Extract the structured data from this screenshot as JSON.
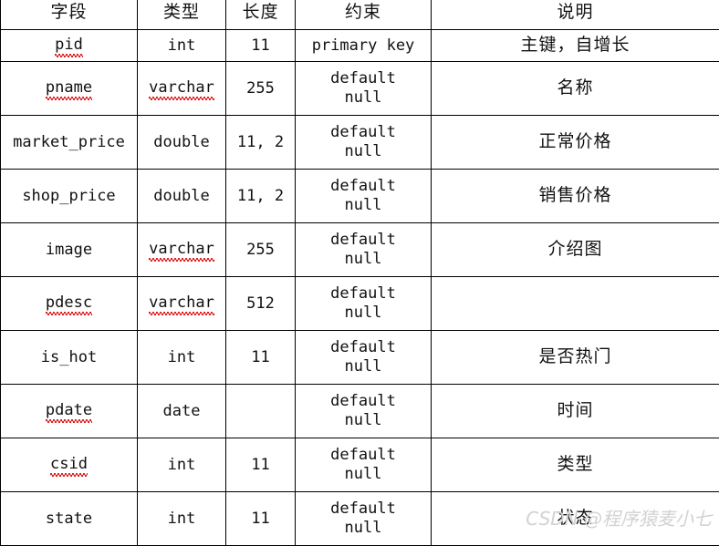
{
  "table": {
    "headers": [
      {
        "label": "字段",
        "key": "field"
      },
      {
        "label": "类型",
        "key": "type"
      },
      {
        "label": "长度",
        "key": "length"
      },
      {
        "label": "约束",
        "key": "constraint"
      },
      {
        "label": "说明",
        "key": "description"
      }
    ],
    "rows": [
      {
        "field": "pid",
        "field_misspelled": true,
        "type": "int",
        "type_misspelled": false,
        "length": "11",
        "constraint": "primary key",
        "description": "主键，自增长"
      },
      {
        "field": "pname",
        "field_misspelled": true,
        "type": "varchar",
        "type_misspelled": true,
        "length": "255",
        "constraint": "default\nnull",
        "description": "名称"
      },
      {
        "field": "market_price",
        "field_misspelled": false,
        "type": "double",
        "type_misspelled": false,
        "length": "11, 2",
        "constraint": "default\nnull",
        "description": "正常价格"
      },
      {
        "field": "shop_price",
        "field_misspelled": false,
        "type": "double",
        "type_misspelled": false,
        "length": "11, 2",
        "constraint": "default\nnull",
        "description": "销售价格"
      },
      {
        "field": "image",
        "field_misspelled": false,
        "type": "varchar",
        "type_misspelled": true,
        "length": "255",
        "constraint": "default\nnull",
        "description": "介绍图"
      },
      {
        "field": "pdesc",
        "field_misspelled": true,
        "type": "varchar",
        "type_misspelled": true,
        "length": "512",
        "constraint": "default\nnull",
        "description": ""
      },
      {
        "field": "is_hot",
        "field_misspelled": false,
        "type": "int",
        "type_misspelled": false,
        "length": "11",
        "constraint": "default\nnull",
        "description": "是否热门"
      },
      {
        "field": "pdate",
        "field_misspelled": true,
        "type": "date",
        "type_misspelled": false,
        "length": "",
        "constraint": "default\nnull",
        "description": "时间"
      },
      {
        "field": "csid",
        "field_misspelled": true,
        "type": "int",
        "type_misspelled": false,
        "length": "11",
        "constraint": "default\nnull",
        "description": "类型"
      },
      {
        "field": "state",
        "field_misspelled": false,
        "type": "int",
        "type_misspelled": false,
        "length": "11",
        "constraint": "default\nnull",
        "description": "状态"
      }
    ]
  },
  "watermark": {
    "text": "CSDN @程序猿麦小七"
  },
  "colors": {
    "border": "#000000",
    "text": "#111111",
    "spellcheck": "#e02020",
    "watermark": "#d2d2d2",
    "background": "#ffffff"
  }
}
